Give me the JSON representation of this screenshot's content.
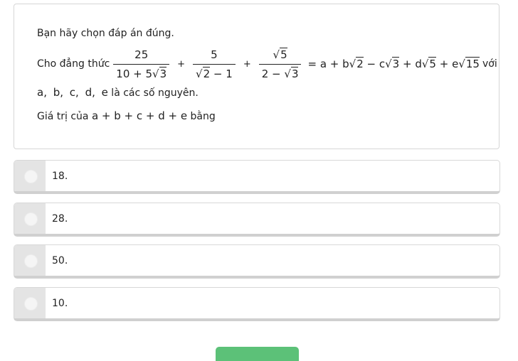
{
  "question": {
    "instruction": "Bạn hãy chọn đáp án đúng.",
    "eq_prefix": "Cho đẳng thức",
    "frac1": {
      "num": "25",
      "den_a": "10 + 5",
      "den_rad": "3"
    },
    "plus1": "+",
    "frac2": {
      "num": "5",
      "den_rad": "2",
      "den_b": " − 1"
    },
    "plus2": "+",
    "frac3": {
      "num_rad": "5",
      "den_a": "2 − ",
      "den_rad": "3"
    },
    "rhs": {
      "lead": "= a + b",
      "r1": "2",
      "m1": " − c",
      "r2": "3",
      "m2": " + d",
      "r3": "5",
      "m3": " + e",
      "r4": "15"
    },
    "eq_suffix": "với",
    "vars": "a, b, c, d, e",
    "vars_suffix": " là các số nguyên.",
    "value_prefix": "Giá trị của ",
    "value_expr": "a + b + c + d + e",
    "value_suffix": " bằng"
  },
  "options": [
    {
      "label": "18."
    },
    {
      "label": "28."
    },
    {
      "label": "50."
    },
    {
      "label": "10."
    }
  ],
  "colors": {
    "submit": "#5cc178",
    "radio_col": "#e4e4e4"
  }
}
